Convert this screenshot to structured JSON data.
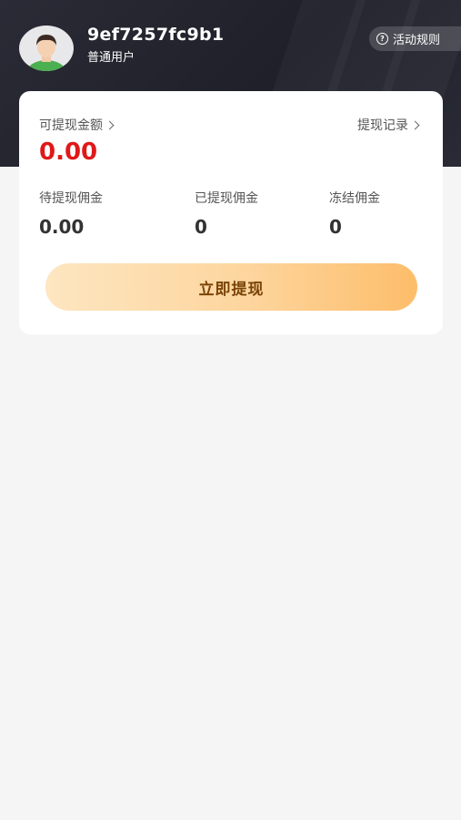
{
  "user": {
    "name": "9ef7257fc9b1",
    "role": "普通用户"
  },
  "header": {
    "rules_label": "活动规则",
    "rules_icon": "question-circle-icon"
  },
  "card": {
    "balance_label": "可提现金额",
    "balance_value": "0.00",
    "records_label": "提现记录",
    "stats": [
      {
        "label": "待提现佣金",
        "value": "0.00"
      },
      {
        "label": "已提现佣金",
        "value": "0"
      },
      {
        "label": "冻结佣金",
        "value": "0"
      }
    ],
    "withdraw_label": "立即提现"
  },
  "colors": {
    "header_bg": "#24252f",
    "balance_red": "#e01818",
    "button_gradient_start": "#fde6c1",
    "button_gradient_end": "#fdbd6a",
    "button_text": "#7a4308"
  }
}
